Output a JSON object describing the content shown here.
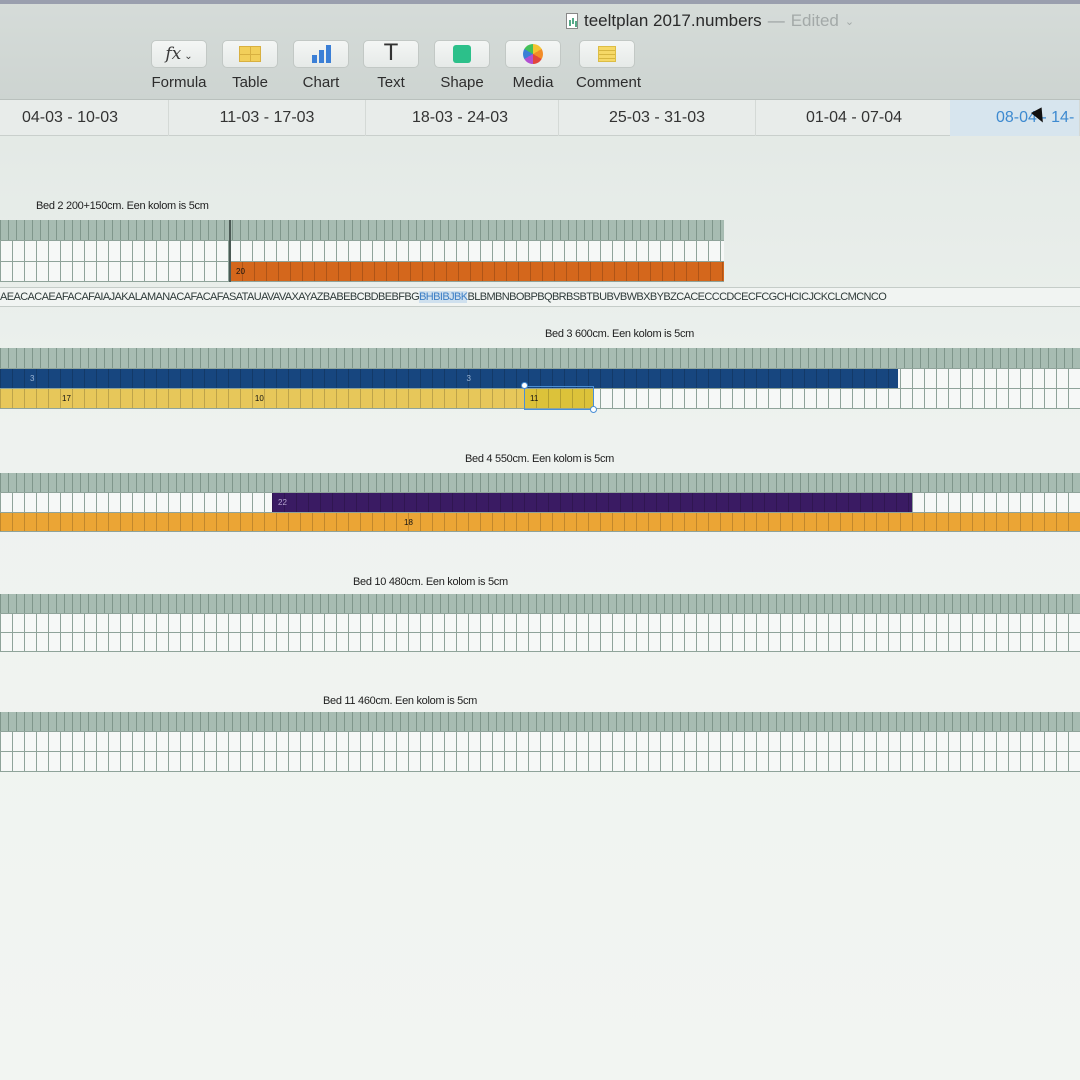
{
  "document": {
    "title": "teeltplan 2017.numbers",
    "separator": "—",
    "status": "Edited"
  },
  "toolbar": {
    "formula_label": "Formula",
    "table_label": "Table",
    "chart_label": "Chart",
    "text_label": "Text",
    "shape_label": "Shape",
    "media_label": "Media",
    "comment_label": "Comment"
  },
  "weeks": [
    "04-03 - 10-03",
    "11-03 - 17-03",
    "18-03 - 24-03",
    "25-03 - 31-03",
    "01-04 - 07-04",
    "08-04 - 14-"
  ],
  "letters_row": {
    "before": "AEACACAEAFACAFAIAJAKALAMANACAFACAFASATAUAVAVAXAYAZBABEBCBDBEBFBG",
    "highlight": "BHBIBJBK",
    "after": "BLBMBNBOBPBQBRBSBTBUBVBWBXBYBZCACECCCDCECFCGCHCICJCKCLCMCNCO"
  },
  "beds": {
    "bed2": {
      "title": "Bed 2 200+150cm. Een kolom is 5cm",
      "bar1_label": "20"
    },
    "bed3": {
      "title": "Bed 3 600cm. Een kolom is 5cm",
      "blue_a": "3",
      "blue_b": "3",
      "yellow_a": "17",
      "yellow_b": "10",
      "yellow_c": "11"
    },
    "bed4": {
      "title": "Bed 4 550cm. Een kolom is 5cm",
      "purple_label": "22",
      "amber_label": "18"
    },
    "bed10": {
      "title": "Bed 10 480cm. Een kolom is 5cm"
    },
    "bed11": {
      "title": "Bed 11 460cm. Een kolom is 5cm"
    }
  },
  "colors": {
    "orange": "#d4671c",
    "blue": "#17467f",
    "yellow": "#dcc23a",
    "purple": "#3a1b63",
    "amber": "#eba535",
    "selection": "#4a8fd6"
  }
}
